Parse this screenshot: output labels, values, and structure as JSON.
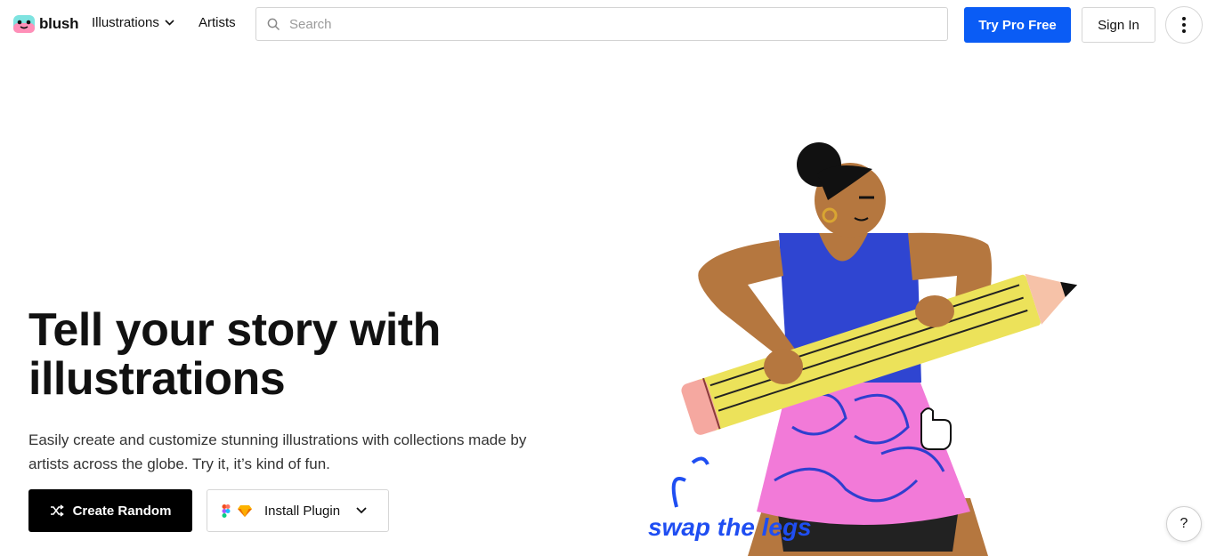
{
  "brand": {
    "name": "blush"
  },
  "nav": {
    "illustrations_label": "Illustrations",
    "artists_label": "Artists"
  },
  "search": {
    "placeholder": "Search"
  },
  "header_actions": {
    "try_pro_label": "Try Pro Free",
    "sign_in_label": "Sign In"
  },
  "hero": {
    "title": "Tell your story with illustrations",
    "subtitle": "Easily create and customize stunning illustrations with collections made by artists across the globe. Try it, it’s kind of fun.",
    "create_random_label": "Create Random",
    "install_plugin_label": "Install Plugin"
  },
  "illustration": {
    "handwritten_text": "swap the legs"
  },
  "help": {
    "label": "?"
  },
  "colors": {
    "primary_blue": "#0a5cf5",
    "black_button": "#000000",
    "skin": "#b5773f",
    "tank_top": "#2f45d1",
    "skirt": "#f27ad8",
    "pencil": "#ece25a"
  }
}
